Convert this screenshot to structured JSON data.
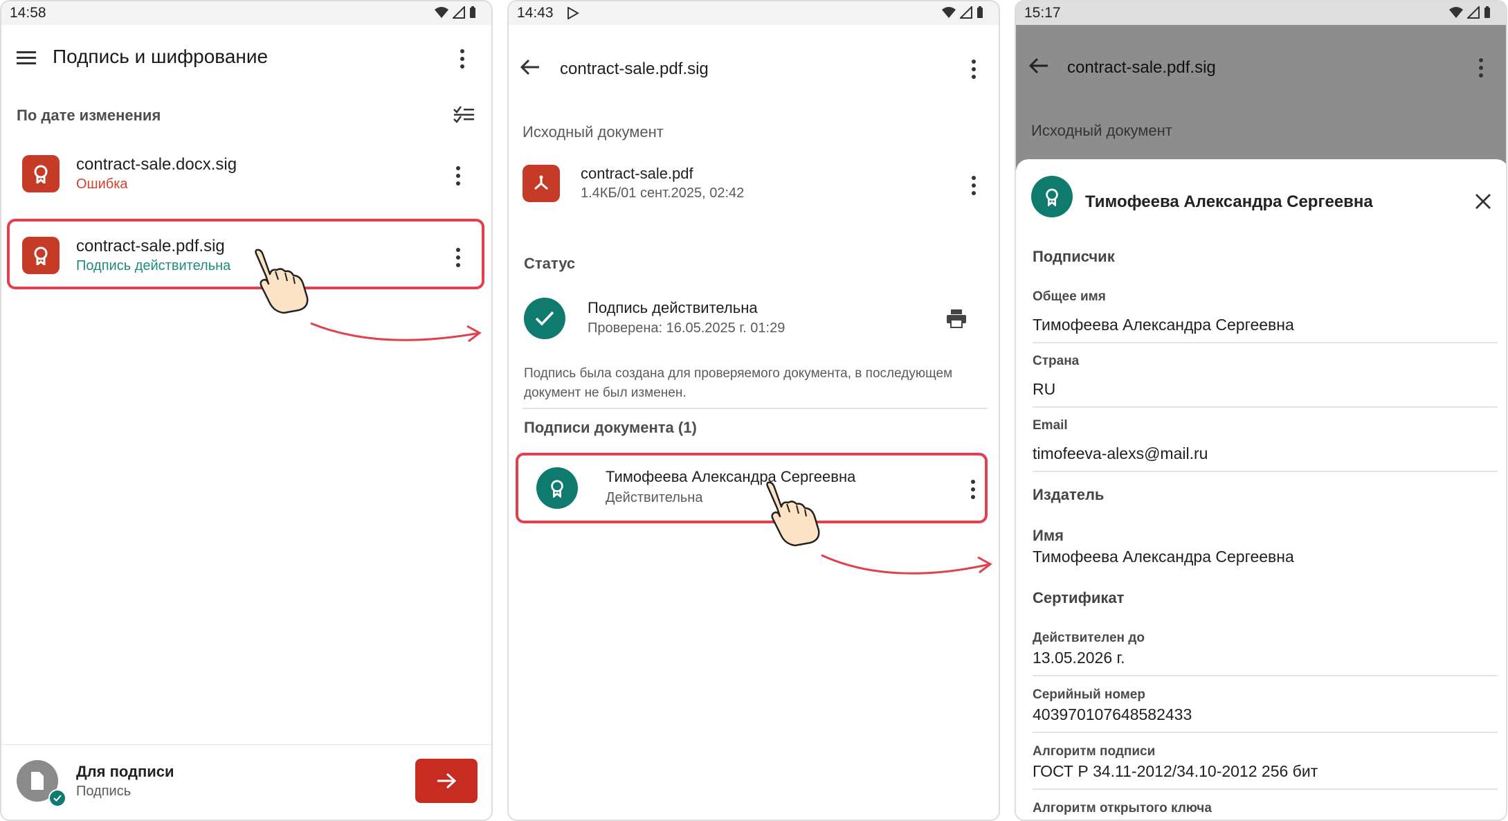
{
  "colors": {
    "accent_red": "#c63a28",
    "teal": "#0f7a6e",
    "highlight": "#e0414c",
    "valid_text": "#1d8c7c",
    "error_text": "#d2402f"
  },
  "screen1": {
    "time": "14:58",
    "title": "Подпись и шифрование",
    "sort_label": "По дате изменения",
    "items": [
      {
        "name": "contract-sale.docx.sig",
        "status": "Ошибка"
      },
      {
        "name": "contract-sale.pdf.sig",
        "status": "Подпись действительна"
      }
    ],
    "footer": {
      "title": "Для подписи",
      "subtitle": "Подпись"
    }
  },
  "screen2": {
    "time": "14:43",
    "title": "contract-sale.pdf.sig",
    "source_header": "Исходный документ",
    "source_file": {
      "name": "contract-sale.pdf",
      "meta": "1.4КБ/01 сент.2025, 02:42"
    },
    "status_header": "Статус",
    "status": {
      "title": "Подпись действительна",
      "checked": "Проверена: 16.05.2025 г. 01:29"
    },
    "description": "Подпись была создана для проверяемого документа, в последующем документ не был изменен.",
    "signatures_header": "Подписи документа (1)",
    "signer": {
      "name": "Тимофеева Александра Сергеевна",
      "status": "Действительна"
    }
  },
  "screen3": {
    "time": "15:17",
    "title": "contract-sale.pdf.sig",
    "source_header": "Исходный документ",
    "sheet_title": "Тимофеева Александра Сергеевна",
    "subscriber_header": "Подписчик",
    "common_name_label": "Общее имя",
    "common_name": "Тимофеева Александра Сергеевна",
    "country_label": "Страна",
    "country": "RU",
    "email_label": "Email",
    "email": "timofeeva-alexs@mail.ru",
    "issuer_header": "Издатель",
    "issuer_name_label": "Имя",
    "issuer_name": "Тимофеева Александра Сергеевна",
    "cert_header": "Сертификат",
    "valid_until_label": "Действителен до",
    "valid_until": "13.05.2026 г.",
    "serial_label": "Серийный номер",
    "serial": "403970107648582433",
    "sig_alg_label": "Алгоритм подписи",
    "sig_alg": "ГОСТ Р 34.11-2012/34.10-2012 256 бит",
    "pubkey_alg_label": "Алгоритм открытого ключа"
  }
}
